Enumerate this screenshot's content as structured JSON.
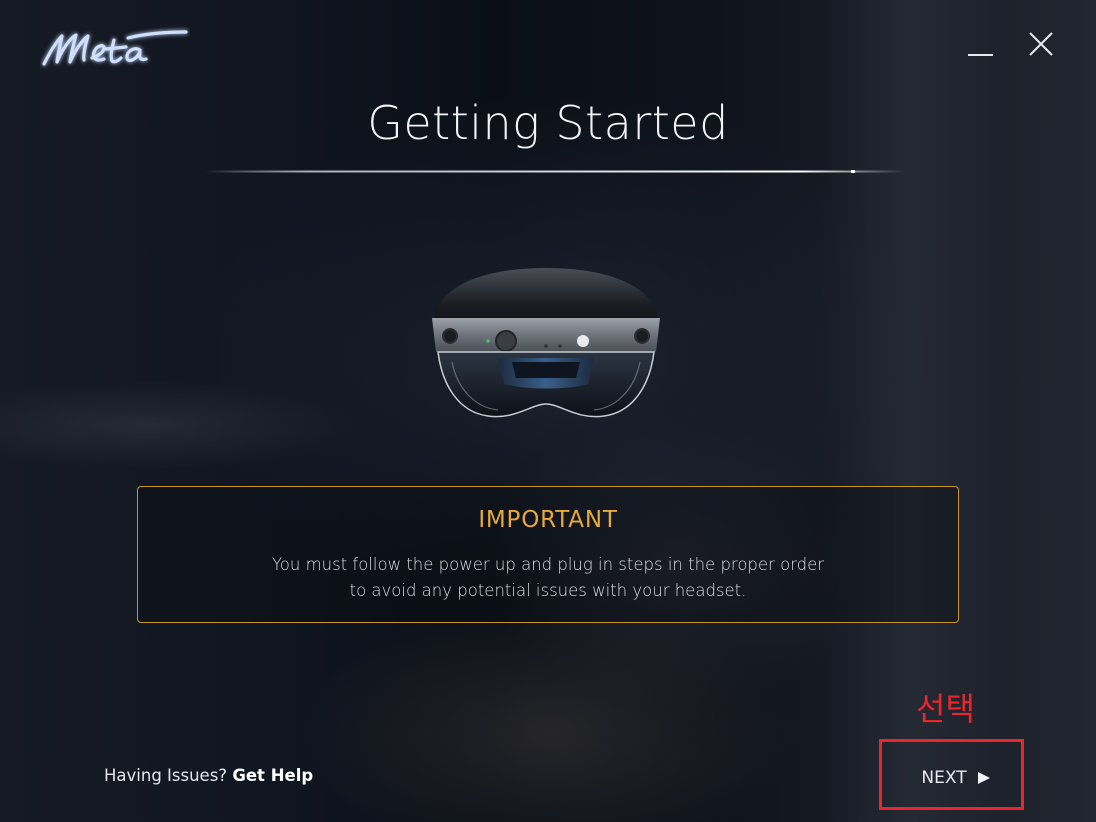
{
  "window": {
    "brand": "Meta",
    "minimize_icon": "minimize-icon",
    "close_icon": "close-icon"
  },
  "page": {
    "title": "Getting Started"
  },
  "device": {
    "image": "headset-image"
  },
  "notice": {
    "heading": "IMPORTANT",
    "line1": "You must follow the power up and plug in steps in the proper order",
    "line2": "to avoid any potential issues with your headset."
  },
  "footer": {
    "help_prefix": "Having Issues?",
    "help_link": "Get Help",
    "next_label": "NEXT",
    "next_icon": "play-arrow-icon"
  },
  "annotation": {
    "label": "선택",
    "color": "#e8262c"
  },
  "colors": {
    "accent_gold": "#c9942e",
    "heading_gold": "#e6a93a",
    "text_light": "#e8ebf0"
  }
}
